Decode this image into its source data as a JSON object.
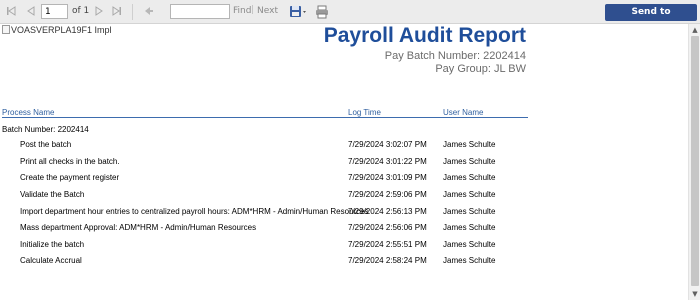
{
  "toolbar": {
    "page_current": "1",
    "page_of": "of 1",
    "find_label": "Find",
    "next_label": "Next",
    "send_label": "Send to myReports"
  },
  "report": {
    "logo_alt": "VOASVERPLA19F1 Impl",
    "title": "Payroll Audit Report",
    "pay_batch_number": "Pay Batch Number: 2202414",
    "pay_group": "Pay Group: JL BW",
    "columns": {
      "process_name": "Process Name",
      "log_time": "Log Time",
      "user_name": "User Name"
    },
    "batch_header": "Batch Number: 2202414",
    "rows": [
      {
        "process": "Post the batch",
        "time": "7/29/2024 3:02:07 PM",
        "user": "James Schulte"
      },
      {
        "process": "Print all checks in the batch.",
        "time": "7/29/2024 3:01:22 PM",
        "user": "James Schulte"
      },
      {
        "process": "Create the payment register",
        "time": "7/29/2024 3:01:09 PM",
        "user": "James Schulte"
      },
      {
        "process": "Validate the Batch",
        "time": "7/29/2024 2:59:06 PM",
        "user": "James Schulte"
      },
      {
        "process": "Import department hour entries to centralized payroll hours: ADM*HRM - Admin/Human Resources",
        "time": "7/29/2024 2:56:13 PM",
        "user": "James Schulte"
      },
      {
        "process": "Mass department Approval: ADM*HRM - Admin/Human Resources",
        "time": "7/29/2024 2:56:06 PM",
        "user": "James Schulte"
      },
      {
        "process": "Initialize the batch",
        "time": "7/29/2024 2:55:51 PM",
        "user": "James Schulte"
      },
      {
        "process": "Calculate Accrual",
        "time": "7/29/2024 2:58:24 PM",
        "user": "James Schulte"
      }
    ]
  }
}
